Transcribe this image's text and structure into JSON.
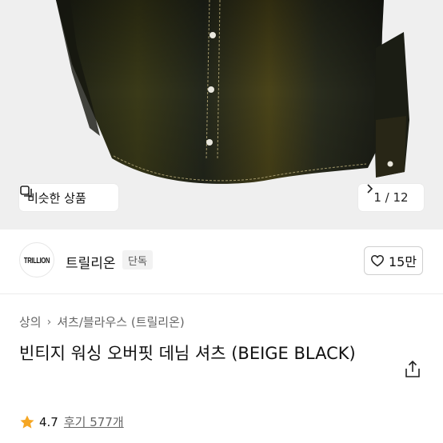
{
  "hero": {
    "similar_label": "비슷한 상품",
    "page_indicator": "1 / 12"
  },
  "store": {
    "logo_text": "TRILLION",
    "name": "트릴리온",
    "badge": "단독",
    "like_count": "15만"
  },
  "breadcrumb": [
    "상의",
    "셔츠/블라우스 (트릴리온)"
  ],
  "product": {
    "title": "빈티지 워싱 오버핏 데님 셔츠 (BEIGE BLACK)"
  },
  "rating": {
    "score": "4.7",
    "reviews": "후기 577개"
  },
  "colors": {
    "star": "#f5a623",
    "hero_bg": "#efefef"
  }
}
